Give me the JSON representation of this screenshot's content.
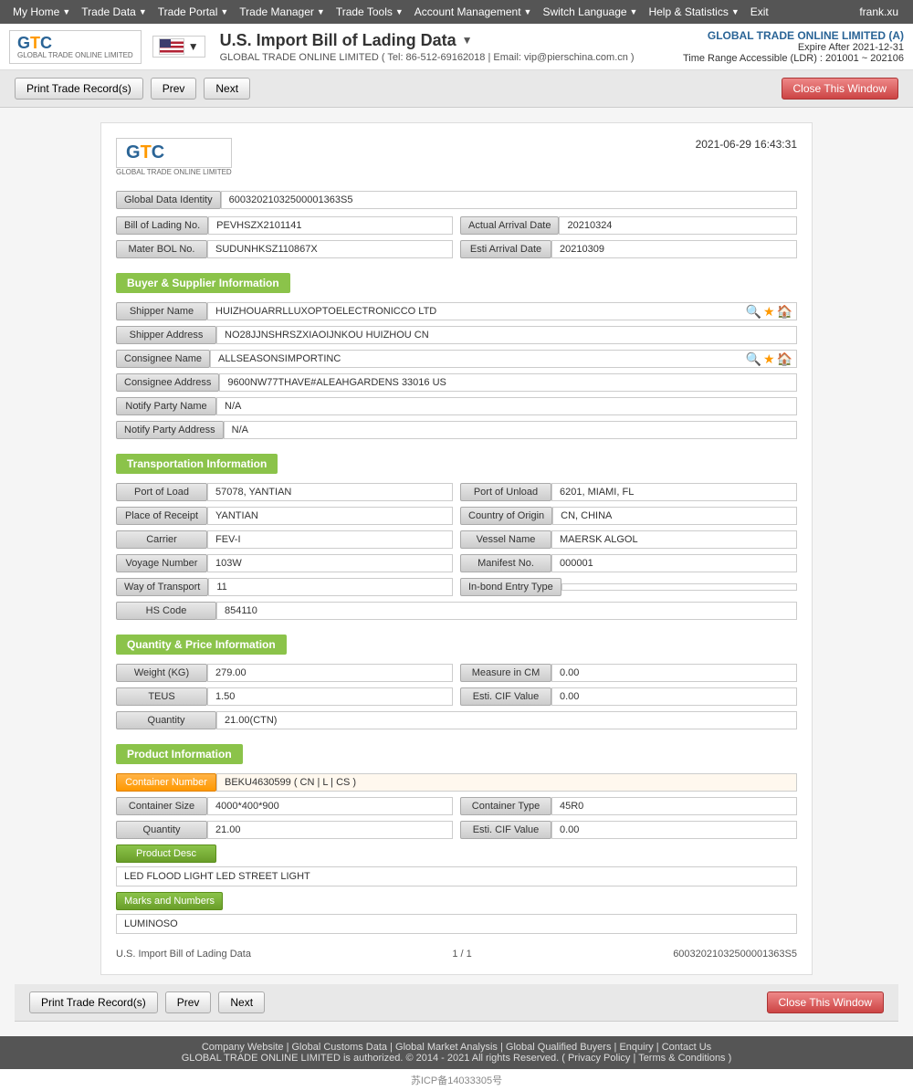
{
  "nav": {
    "items": [
      {
        "label": "My Home",
        "arrow": true
      },
      {
        "label": "Trade Data",
        "arrow": true
      },
      {
        "label": "Trade Portal",
        "arrow": true
      },
      {
        "label": "Trade Manager",
        "arrow": true
      },
      {
        "label": "Trade Tools",
        "arrow": true
      },
      {
        "label": "Account Management",
        "arrow": true
      },
      {
        "label": "Switch Language",
        "arrow": true
      },
      {
        "label": "Help & Statistics",
        "arrow": true
      },
      {
        "label": "Exit",
        "arrow": false
      }
    ],
    "user": "frank.xu"
  },
  "header": {
    "logo_text": "GTC",
    "logo_sub": "GLOBAL TRADE ONLINE LIMITED",
    "page_title": "U.S. Import Bill of Lading Data",
    "subtitle": "GLOBAL TRADE ONLINE LIMITED ( Tel: 86-512-69162018 | Email: vip@pierschina.com.cn )",
    "company": "GLOBAL TRADE ONLINE LIMITED (A)",
    "expire": "Expire After 2021-12-31",
    "time_range": "Time Range Accessible (LDR) : 201001 ~ 202106"
  },
  "toolbar": {
    "print_label": "Print Trade Record(s)",
    "prev_label": "Prev",
    "next_label": "Next",
    "close_label": "Close This Window"
  },
  "record": {
    "date": "2021-06-29 16:43:31",
    "global_data_id_label": "Global Data Identity",
    "global_data_id_value": "60032021032500001363S5",
    "bill_of_lading_label": "Bill of Lading No.",
    "bill_of_lading_value": "PEVHSZX2101141",
    "actual_arrival_label": "Actual Arrival Date",
    "actual_arrival_value": "20210324",
    "mater_bol_label": "Mater BOL No.",
    "mater_bol_value": "SUDUNHKSZ110867X",
    "esti_arrival_label": "Esti Arrival Date",
    "esti_arrival_value": "20210309",
    "sections": {
      "buyer_supplier": {
        "title": "Buyer & Supplier Information",
        "shipper_name_label": "Shipper Name",
        "shipper_name_value": "HUIZHOUARRLLUXOPTOELECTRONICCO LTD",
        "shipper_address_label": "Shipper Address",
        "shipper_address_value": "NO28JJNSHRSZXIAOIJNKOU HUIZHOU CN",
        "consignee_name_label": "Consignee Name",
        "consignee_name_value": "ALLSEASONSIMPORTINC",
        "consignee_address_label": "Consignee Address",
        "consignee_address_value": "9600NW77THAVE#ALEAHGARDENS 33016 US",
        "notify_party_name_label": "Notify Party Name",
        "notify_party_name_value": "N/A",
        "notify_party_address_label": "Notify Party Address",
        "notify_party_address_value": "N/A"
      },
      "transportation": {
        "title": "Transportation Information",
        "port_of_load_label": "Port of Load",
        "port_of_load_value": "57078, YANTIAN",
        "port_of_unload_label": "Port of Unload",
        "port_of_unload_value": "6201, MIAMI, FL",
        "place_of_receipt_label": "Place of Receipt",
        "place_of_receipt_value": "YANTIAN",
        "country_of_origin_label": "Country of Origin",
        "country_of_origin_value": "CN, CHINA",
        "carrier_label": "Carrier",
        "carrier_value": "FEV-I",
        "vessel_name_label": "Vessel Name",
        "vessel_name_value": "MAERSK ALGOL",
        "voyage_number_label": "Voyage Number",
        "voyage_number_value": "103W",
        "manifest_no_label": "Manifest No.",
        "manifest_no_value": "000001",
        "way_of_transport_label": "Way of Transport",
        "way_of_transport_value": "11",
        "inbond_entry_label": "In-bond Entry Type",
        "inbond_entry_value": "",
        "hs_code_label": "HS Code",
        "hs_code_value": "854110"
      },
      "quantity_price": {
        "title": "Quantity & Price Information",
        "weight_label": "Weight (KG)",
        "weight_value": "279.00",
        "measure_cm_label": "Measure in CM",
        "measure_cm_value": "0.00",
        "teus_label": "TEUS",
        "teus_value": "1.50",
        "esti_cif_label": "Esti. CIF Value",
        "esti_cif_value": "0.00",
        "quantity_label": "Quantity",
        "quantity_value": "21.00(CTN)"
      },
      "product": {
        "title": "Product Information",
        "container_number_label": "Container Number",
        "container_number_value": "BEKU4630599 ( CN | L | CS )",
        "container_size_label": "Container Size",
        "container_size_value": "4000*400*900",
        "container_type_label": "Container Type",
        "container_type_value": "45R0",
        "quantity_label": "Quantity",
        "quantity_value": "21.00",
        "esti_cif_label": "Esti. CIF Value",
        "esti_cif_value": "0.00",
        "product_desc_label": "Product Desc",
        "product_desc_value": "LED FLOOD LIGHT LED STREET LIGHT",
        "marks_label": "Marks and Numbers",
        "marks_value": "LUMINOSO"
      }
    },
    "footer_left": "U.S. Import Bill of Lading Data",
    "footer_pages": "1 / 1",
    "footer_id": "60032021032500001363S5"
  },
  "footer": {
    "links": [
      "Company Website",
      "Global Customs Data",
      "Global Market Analysis",
      "Global Qualified Buyers",
      "Enquiry",
      "Contact Us"
    ],
    "copyright": "GLOBAL TRADE ONLINE LIMITED is authorized.  © 2014 - 2021 All rights Reserved.  (",
    "privacy": "Privacy Policy",
    "terms": "Terms & Conditions",
    "icp": "苏ICP备14033305号"
  }
}
